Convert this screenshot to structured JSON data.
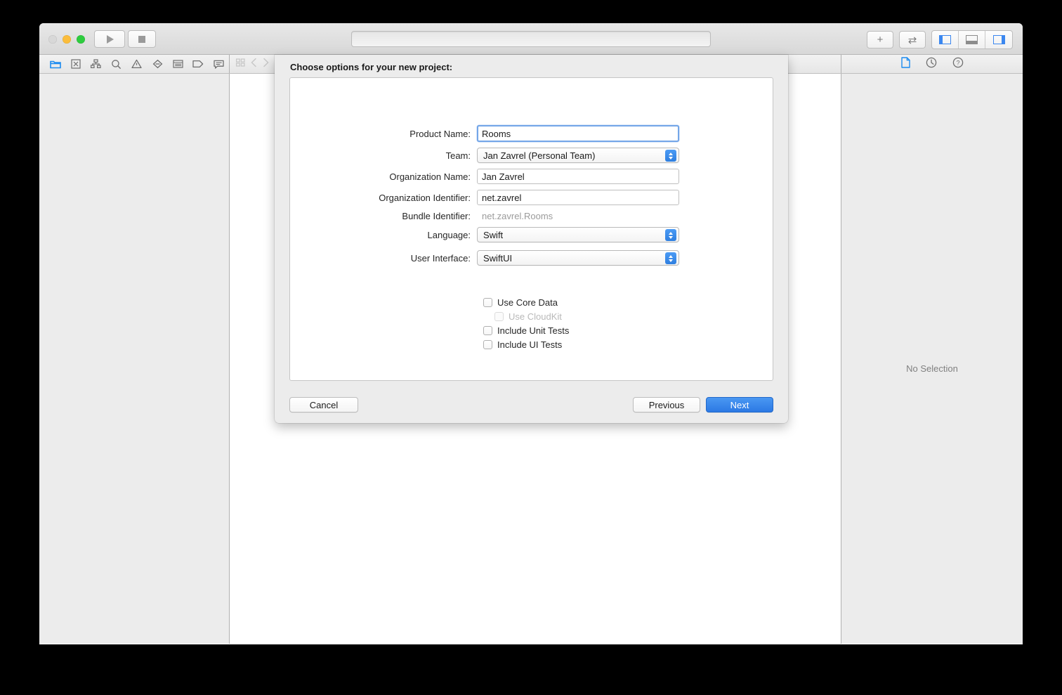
{
  "window": {
    "traffic_lights": [
      "close",
      "minimize",
      "zoom"
    ],
    "toolbar": {
      "run_label": "Run",
      "stop_label": "Stop",
      "add_label": "+",
      "swap_label": "⇄",
      "status_text": ""
    }
  },
  "navigator_bar": {
    "items": [
      {
        "name": "project-navigator",
        "icon": "folder-icon",
        "active": true
      },
      {
        "name": "source-control-navigator",
        "icon": "source-control-icon",
        "active": false
      },
      {
        "name": "symbol-navigator",
        "icon": "hierarchy-icon",
        "active": false
      },
      {
        "name": "find-navigator",
        "icon": "search-icon",
        "active": false
      },
      {
        "name": "issue-navigator",
        "icon": "warning-triangle-icon",
        "active": false
      },
      {
        "name": "test-navigator",
        "icon": "diamond-icon",
        "active": false
      },
      {
        "name": "debug-navigator",
        "icon": "list-icon",
        "active": false
      },
      {
        "name": "breakpoint-navigator",
        "icon": "tag-icon",
        "active": false
      },
      {
        "name": "report-navigator",
        "icon": "speech-bubble-icon",
        "active": false
      }
    ]
  },
  "editor_bar": {
    "items": [
      {
        "name": "related-items",
        "icon": "grid-icon",
        "enabled": false
      },
      {
        "name": "go-back",
        "icon": "chevron-left-icon",
        "enabled": false
      },
      {
        "name": "go-forward",
        "icon": "chevron-right-icon",
        "enabled": false
      }
    ]
  },
  "inspector_bar": {
    "items": [
      {
        "name": "file-inspector",
        "icon": "document-icon",
        "active": true
      },
      {
        "name": "history-inspector",
        "icon": "clock-icon",
        "active": false
      },
      {
        "name": "quick-help-inspector",
        "icon": "question-mark-icon",
        "active": false
      }
    ]
  },
  "inspector": {
    "empty_text": "No Selection"
  },
  "sheet": {
    "title": "Choose options for your new project:",
    "fields": [
      {
        "label": "Product Name:",
        "value": "Rooms",
        "type": "textfield",
        "focused": true
      },
      {
        "label": "Team:",
        "value": "Jan Zavrel (Personal Team)",
        "type": "popup"
      },
      {
        "label": "Organization Name:",
        "value": "Jan Zavrel",
        "type": "textfield"
      },
      {
        "label": "Organization Identifier:",
        "value": "net.zavrel",
        "type": "textfield"
      },
      {
        "label": "Bundle Identifier:",
        "value": "net.zavrel.Rooms",
        "type": "static"
      },
      {
        "label": "Language:",
        "value": "Swift",
        "type": "popup"
      },
      {
        "label": "User Interface:",
        "value": "SwiftUI",
        "type": "popup"
      }
    ],
    "checkboxes": [
      {
        "label": "Use Core Data",
        "checked": false,
        "enabled": true,
        "indent": false
      },
      {
        "label": "Use CloudKit",
        "checked": false,
        "enabled": false,
        "indent": true
      },
      {
        "label": "Include Unit Tests",
        "checked": false,
        "enabled": true,
        "indent": false
      },
      {
        "label": "Include UI Tests",
        "checked": false,
        "enabled": true,
        "indent": false
      }
    ],
    "buttons": {
      "cancel": "Cancel",
      "previous": "Previous",
      "next": "Next"
    }
  },
  "colors": {
    "accent_blue": "#2c79e4",
    "focus_ring": "#74a6e8",
    "window_chrome": "#ececec",
    "traffic_yellow": "#fbbd3c",
    "traffic_green": "#2dcc3e"
  }
}
